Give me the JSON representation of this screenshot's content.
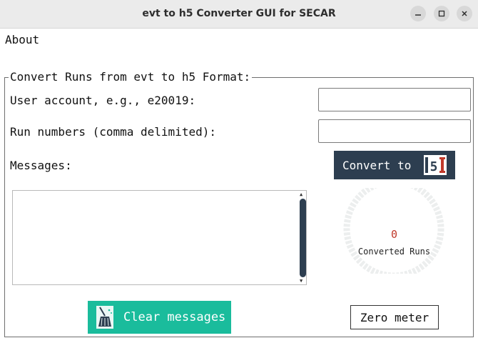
{
  "window": {
    "title": "evt to h5 Converter GUI for SECAR"
  },
  "menu": {
    "about": "About"
  },
  "section": {
    "title": "Convert Runs from evt to h5 Format:"
  },
  "form": {
    "user_label": "User account, e.g., e20019:",
    "user_value": "",
    "runs_label": "Run numbers (comma delimited):",
    "runs_value": "",
    "messages_label": "Messages:"
  },
  "buttons": {
    "convert_label": "Convert to",
    "convert_logo_text": "5",
    "clear_label": "Clear messages",
    "zero_label": "Zero meter"
  },
  "meter": {
    "value": "0",
    "label": "Converted Runs",
    "fraction": 0
  },
  "colors": {
    "accent_dark": "#2d3e50",
    "accent_teal": "#1abc9c",
    "meter_value": "#c0392b",
    "meter_track": "#eceeee"
  },
  "icons": {
    "minimize": "minimize-icon",
    "maximize": "maximize-icon",
    "close": "close-icon",
    "broom": "broom-icon",
    "h5_logo": "h5-logo-icon"
  }
}
